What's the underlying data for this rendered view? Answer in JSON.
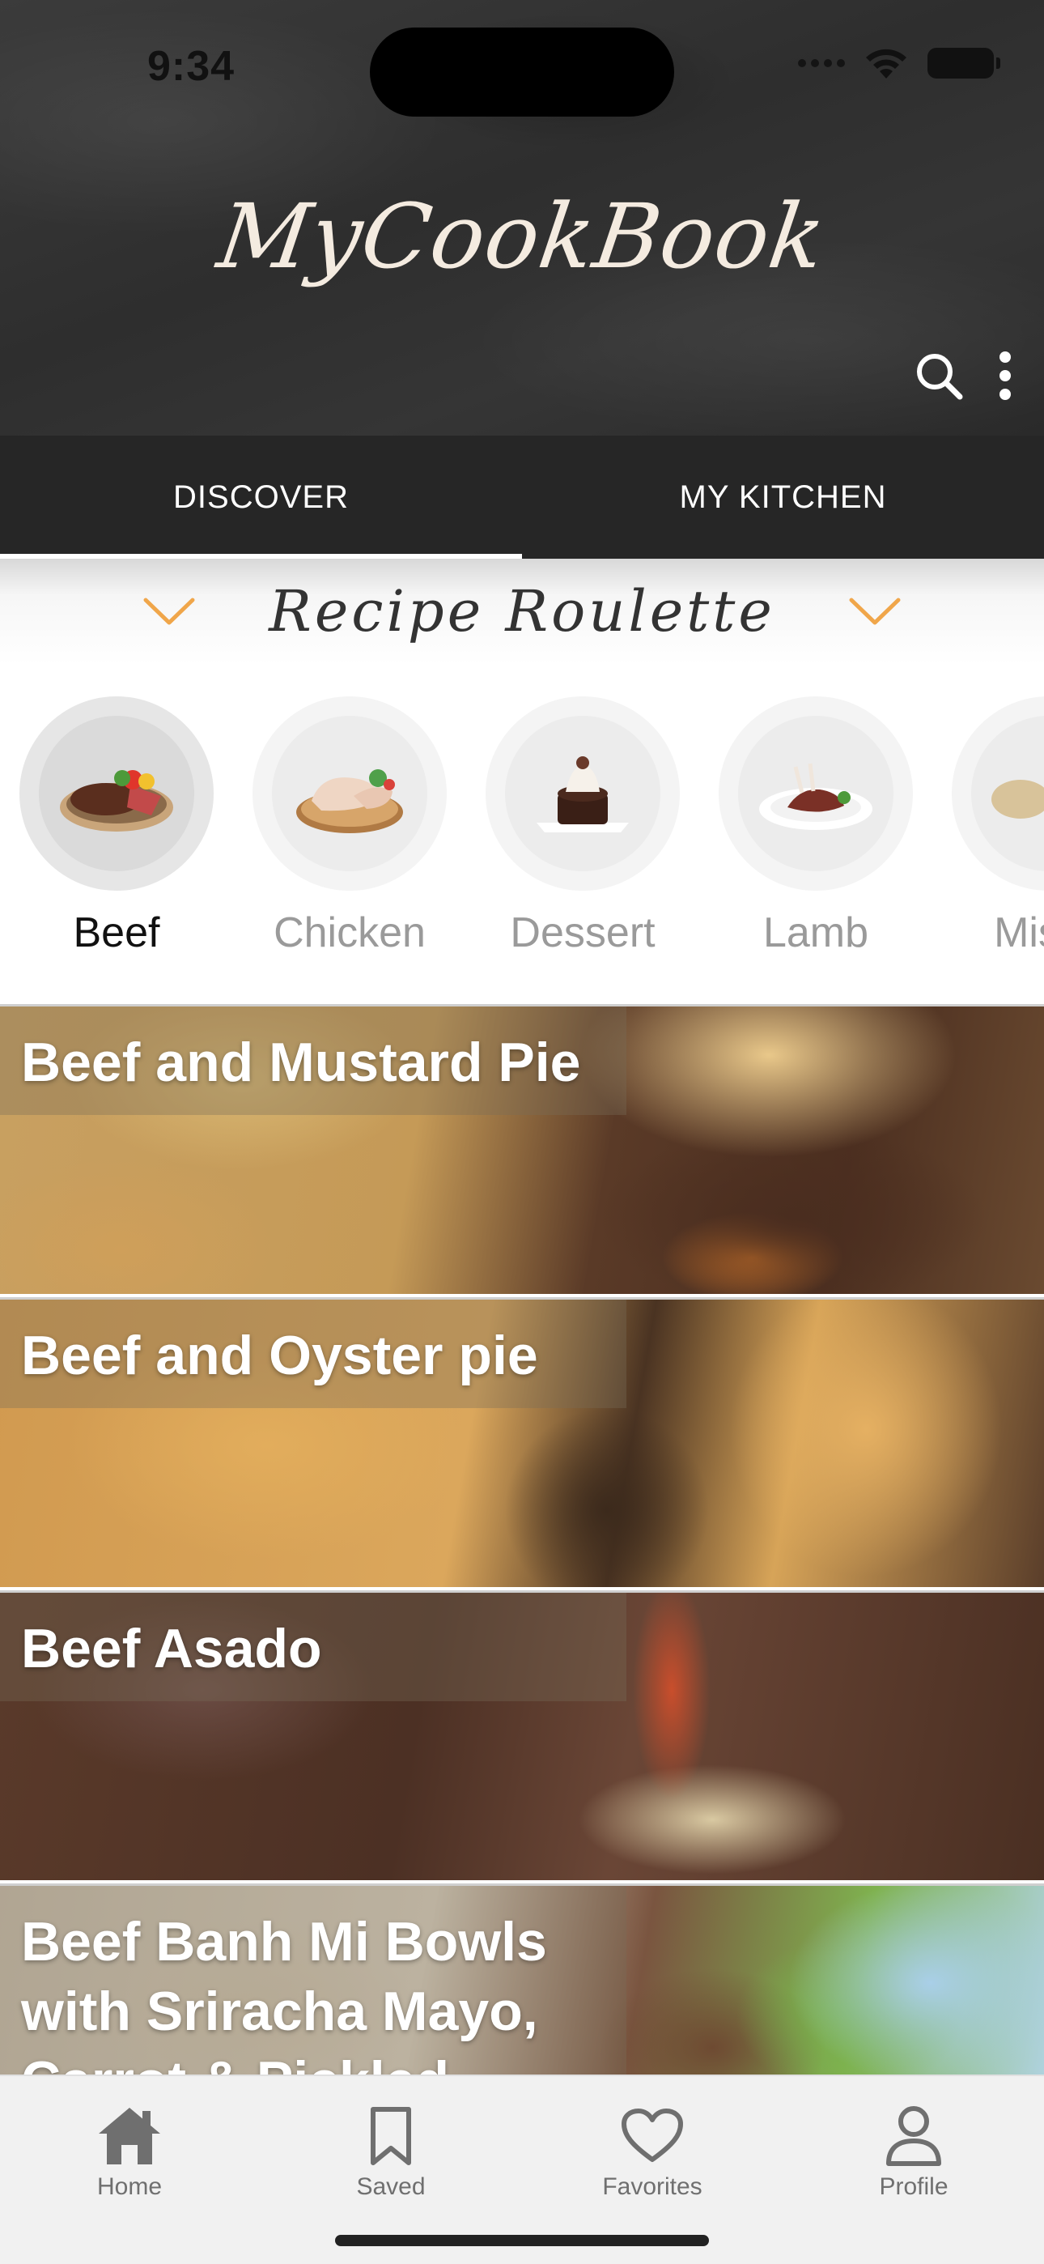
{
  "status_bar": {
    "time": "9:34"
  },
  "app": {
    "title": "MyCookBook"
  },
  "header": {
    "icons": [
      "search-icon",
      "more-vertical-icon"
    ]
  },
  "tabs": [
    {
      "label": "DISCOVER",
      "active": true
    },
    {
      "label": "MY KITCHEN",
      "active": false
    }
  ],
  "roulette": {
    "title": "Recipe Roulette",
    "accent_color": "#f0a64a"
  },
  "categories": [
    {
      "label": "Beef",
      "selected": true
    },
    {
      "label": "Chicken",
      "selected": false
    },
    {
      "label": "Dessert",
      "selected": false
    },
    {
      "label": "Lamb",
      "selected": false
    },
    {
      "label": "Misce",
      "selected": false
    }
  ],
  "recipes": [
    {
      "title": "Beef and Mustard Pie"
    },
    {
      "title": "Beef and Oyster pie"
    },
    {
      "title": "Beef Asado"
    },
    {
      "title": "Beef Banh Mi Bowls with Sriracha Mayo, Carrot & Pickled"
    }
  ],
  "bottom_nav": [
    {
      "label": "Home",
      "icon": "home-icon",
      "active": true
    },
    {
      "label": "Saved",
      "icon": "bookmark-icon",
      "active": false
    },
    {
      "label": "Favorites",
      "icon": "heart-icon",
      "active": false
    },
    {
      "label": "Profile",
      "icon": "person-icon",
      "active": false
    }
  ]
}
